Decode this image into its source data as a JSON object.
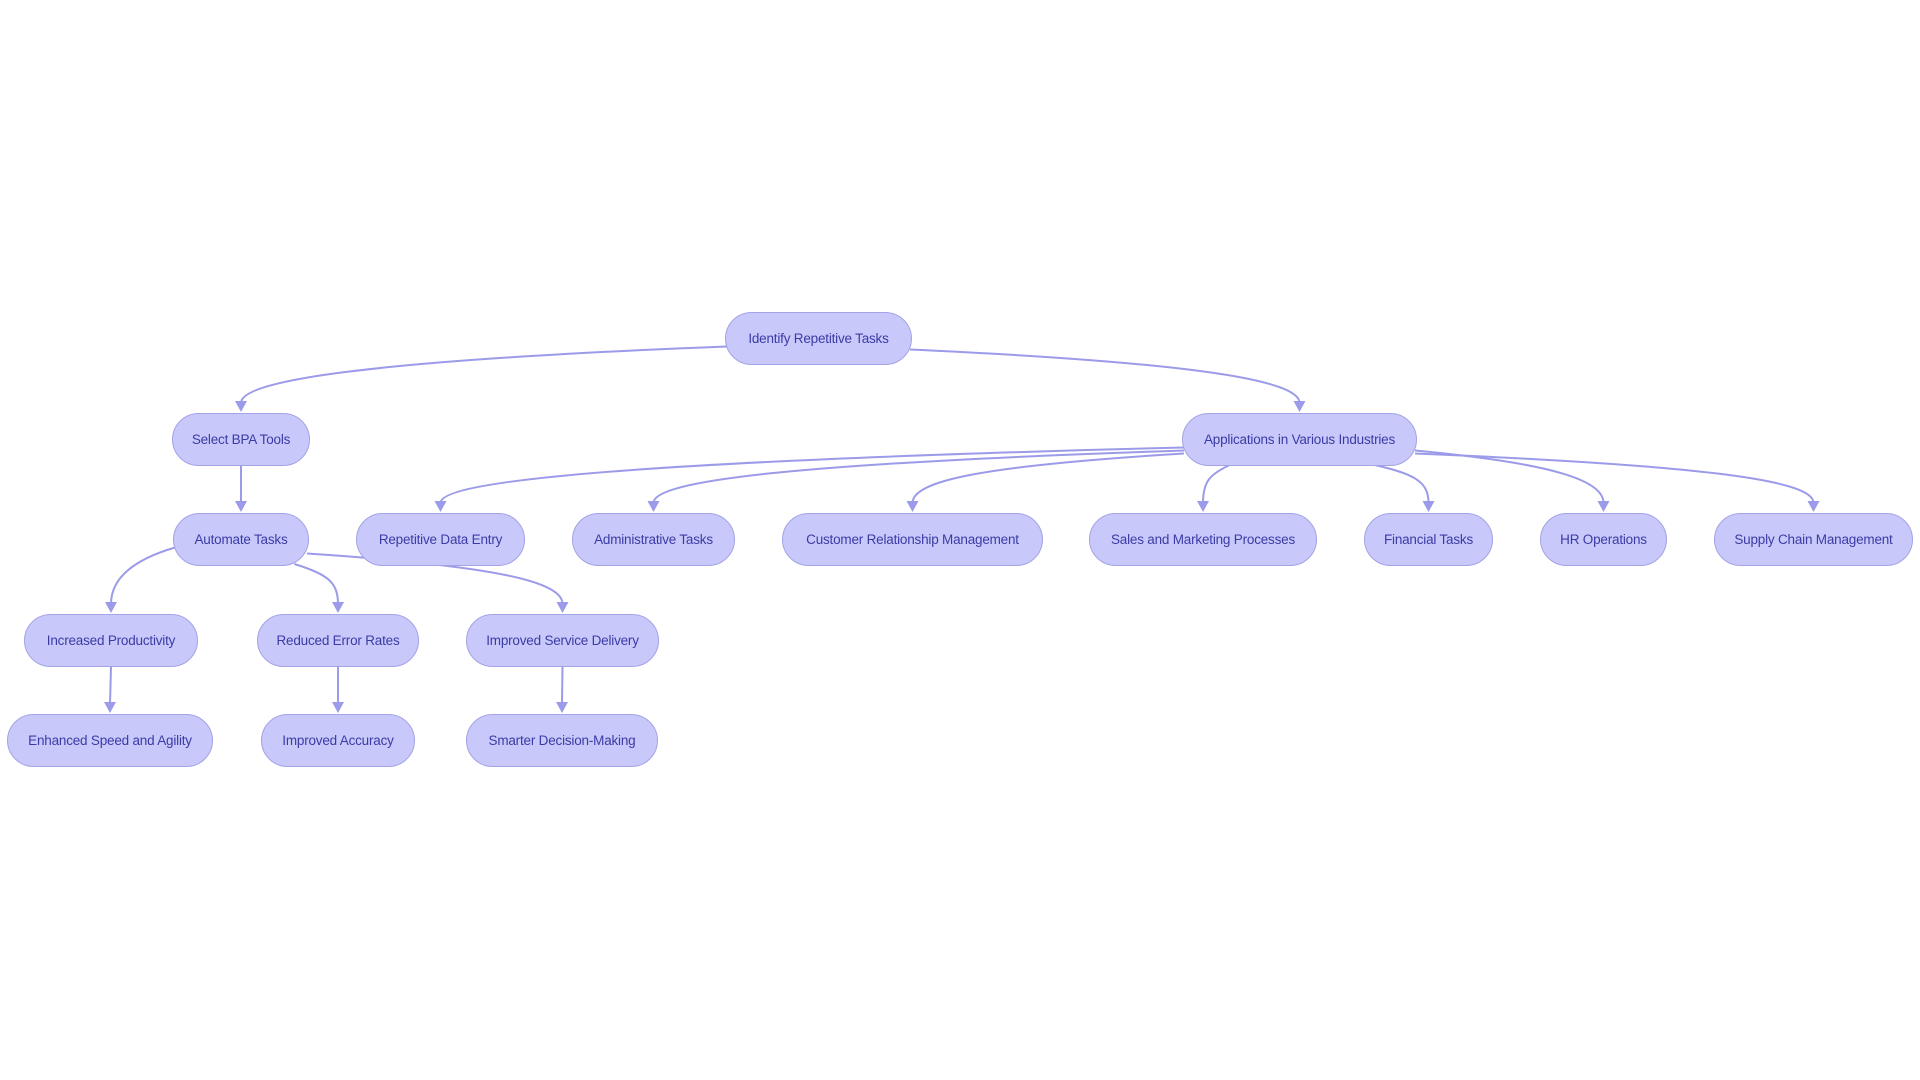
{
  "diagram": {
    "type": "flowchart",
    "nodes": {
      "identify": "Identify Repetitive Tasks",
      "select": "Select BPA Tools",
      "automate": "Automate Tasks",
      "applications": "Applications in Various Industries",
      "productivity": "Increased Productivity",
      "errors": "Reduced Error Rates",
      "service": "Improved Service Delivery",
      "speed": "Enhanced Speed and Agility",
      "accuracy": "Improved Accuracy",
      "decision": "Smarter Decision-Making",
      "dataentry": "Repetitive Data Entry",
      "admin": "Administrative Tasks",
      "crm": "Customer Relationship Management",
      "sales": "Sales and Marketing Processes",
      "financial": "Financial Tasks",
      "hr": "HR Operations",
      "supply": "Supply Chain Management"
    },
    "edges": [
      [
        "identify",
        "select"
      ],
      [
        "identify",
        "applications"
      ],
      [
        "select",
        "automate"
      ],
      [
        "automate",
        "productivity"
      ],
      [
        "automate",
        "errors"
      ],
      [
        "automate",
        "service"
      ],
      [
        "productivity",
        "speed"
      ],
      [
        "errors",
        "accuracy"
      ],
      [
        "service",
        "decision"
      ],
      [
        "applications",
        "dataentry"
      ],
      [
        "applications",
        "admin"
      ],
      [
        "applications",
        "crm"
      ],
      [
        "applications",
        "sales"
      ],
      [
        "applications",
        "financial"
      ],
      [
        "applications",
        "hr"
      ],
      [
        "applications",
        "supply"
      ]
    ],
    "colors": {
      "node_fill": "#c8c8fb",
      "node_border": "#a3a3e6",
      "node_text": "#3b3ba6",
      "edge": "#9b9be9"
    }
  }
}
